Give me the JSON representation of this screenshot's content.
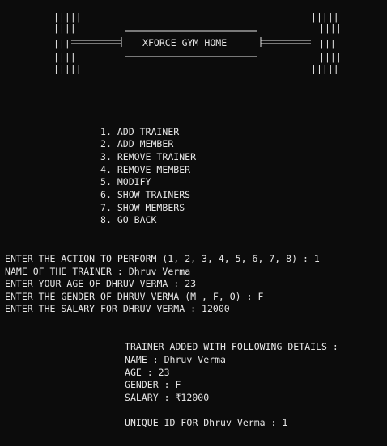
{
  "banner": {
    "art_lines": [
      "|||||                                       |||||",
      "||||      ______________________________     ||||",
      "|||======|       XFORCE GYM HOME        |======|||",
      "||||      ------------------------------     ||||",
      "|||||                                       |||||"
    ],
    "title": "XFORCE GYM HOME"
  },
  "menu": {
    "items": [
      "1. ADD TRAINER",
      "2. ADD MEMBER",
      "3. REMOVE TRAINER",
      "4. REMOVE MEMBER",
      "5. MODIFY",
      "6. SHOW TRAINERS",
      "7. SHOW MEMBERS",
      "8. GO BACK"
    ]
  },
  "prompts": {
    "lines": [
      "ENTER THE ACTION TO PERFORM (1, 2, 3, 4, 5, 6, 7, 8) : 1",
      "NAME OF THE TRAINER : Dhruv Verma",
      "ENTER YOUR AGE OF DHRUV VERMA : 23",
      "ENTER THE GENDER OF DHRUV VERMA (M , F, O) : F",
      "ENTER THE SALARY FOR DHRUV VERMA : 12000"
    ]
  },
  "result": {
    "header": "TRAINER ADDED WITH FOLLOWING DETAILS :",
    "name": "NAME : Dhruv Verma",
    "age": "AGE : 23",
    "gender": "GENDER : F",
    "salary": "SALARY : ₹12000",
    "unique_id": "UNIQUE ID FOR Dhruv Verma : 1"
  }
}
